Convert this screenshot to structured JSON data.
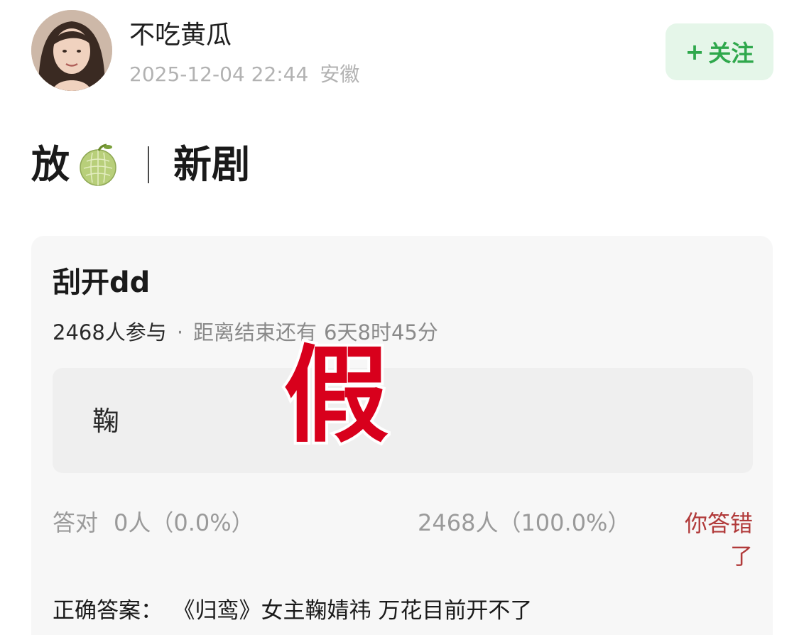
{
  "post": {
    "username": "不吃黄瓜",
    "timestamp": "2025-12-04 22:44",
    "location": "安徽",
    "follow_label": "关注",
    "follow_plus": "+",
    "title_prefix": "放",
    "title_emoji_name": "melon-icon",
    "title_suffix": "新剧"
  },
  "quiz": {
    "title": "刮开dd",
    "participants": "2468人参与",
    "dot": "·",
    "remaining_label": "距离结束还有",
    "remaining_value": "6天8时45分",
    "option_text": "鞠",
    "stamp_text": "假",
    "correct_label": "答对",
    "correct_value": "0人（0.0%）",
    "wrong_value": "2468人（100.0%）",
    "your_result": "你答错了",
    "answer_label": "正确答案：",
    "answer_value": "《归鸾》女主鞠婧祎 万花目前开不了"
  },
  "colors": {
    "follow_bg": "#e5f6e9",
    "follow_text": "#2fa84c",
    "wrong_text": "#b13a3a",
    "stamp_red": "#d8001c"
  }
}
